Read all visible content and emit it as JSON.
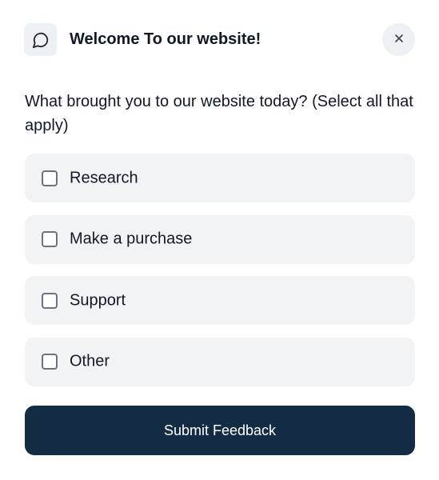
{
  "header": {
    "title": "Welcome To our website!",
    "icon": "chat-bubble-icon",
    "close_icon": "close-icon",
    "close_glyph": "×"
  },
  "question": {
    "text": "What brought you to our website today? (Select all that apply)"
  },
  "options": [
    {
      "label": "Research",
      "checked": false
    },
    {
      "label": "Make a purchase",
      "checked": false
    },
    {
      "label": "Support",
      "checked": false
    },
    {
      "label": "Other",
      "checked": false
    }
  ],
  "submit": {
    "label": "Submit Feedback"
  },
  "colors": {
    "primary": "#132c43",
    "option_background": "#f2f3f5",
    "icon_background": "#eef1f4",
    "checkbox_border": "#6b7280",
    "text": "#111827"
  }
}
